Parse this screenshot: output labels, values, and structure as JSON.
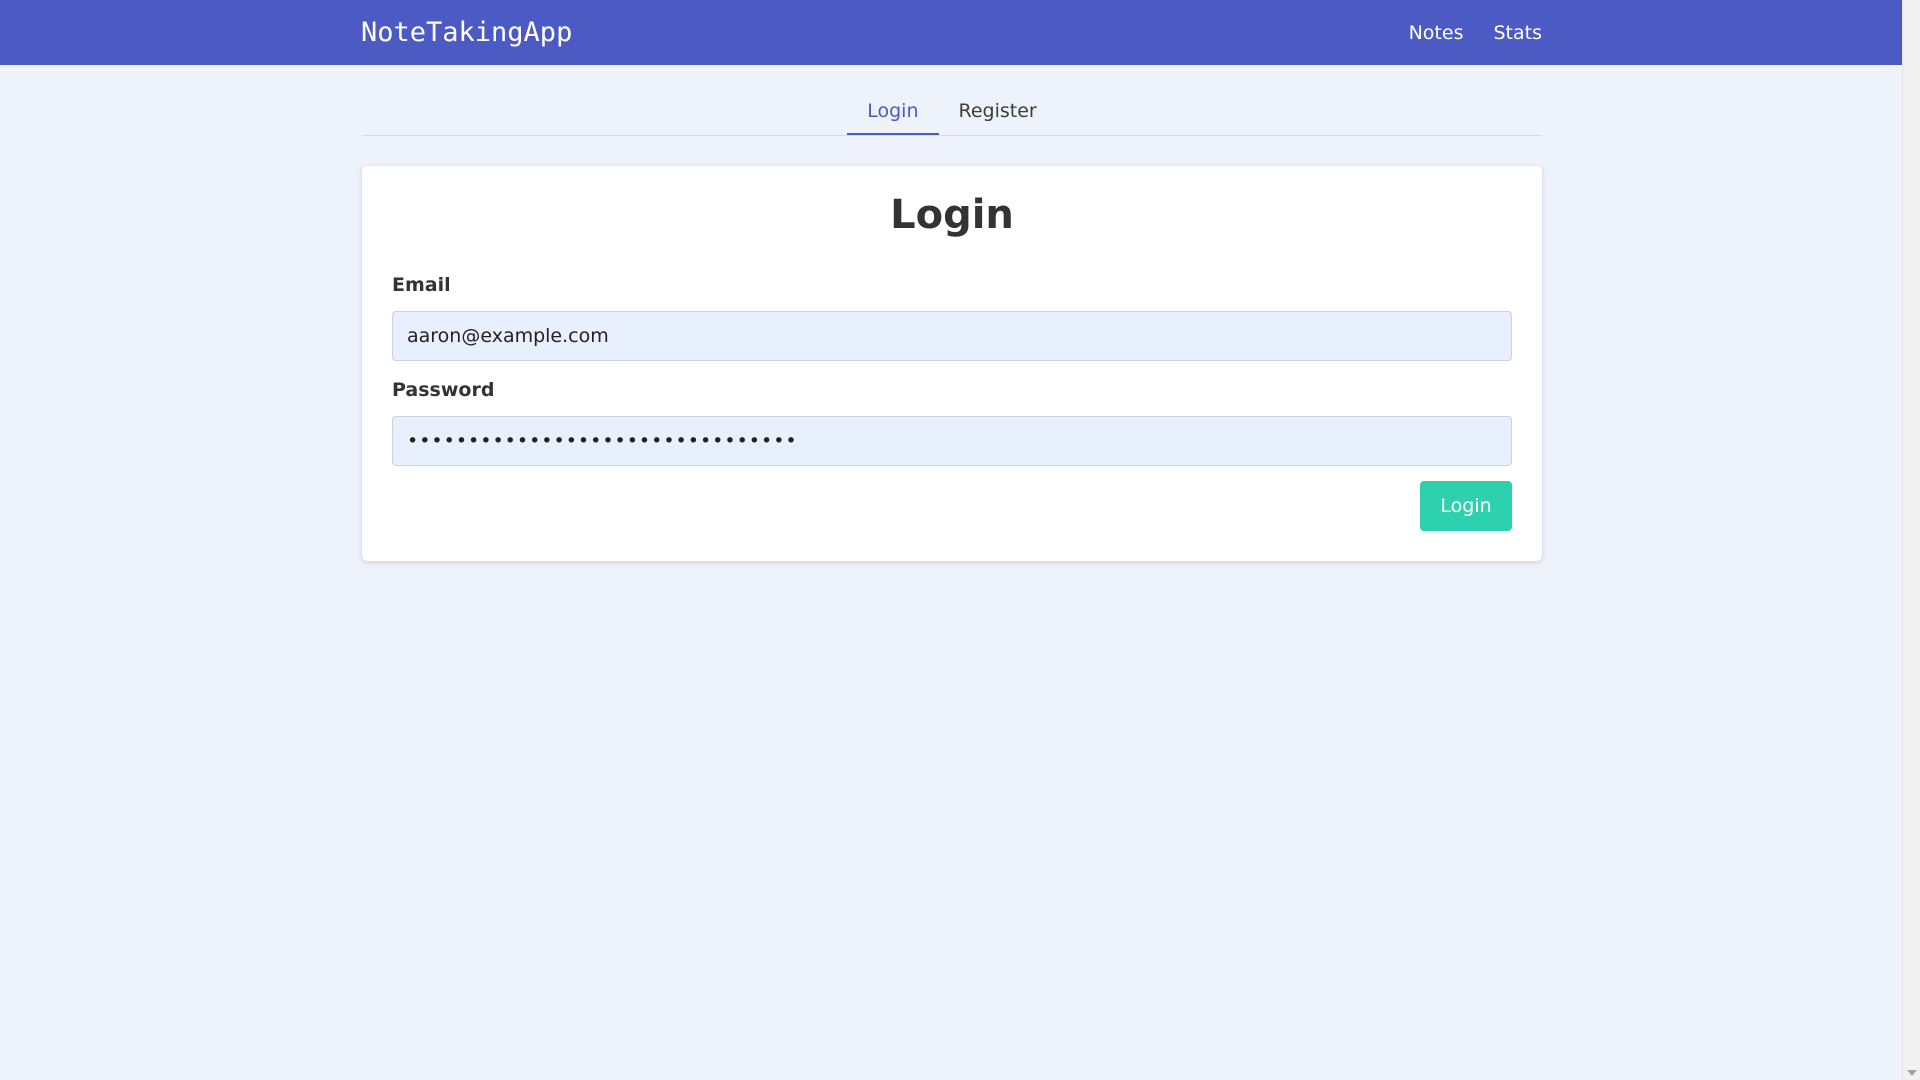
{
  "navbar": {
    "brand": "NoteTakingApp",
    "links": [
      "Notes",
      "Stats"
    ],
    "background": "#4c5ac4"
  },
  "tabs": [
    {
      "label": "Login",
      "active": true
    },
    {
      "label": "Register",
      "active": false
    }
  ],
  "form": {
    "title": "Login",
    "email_label": "Email",
    "email_value": "aaron@example.com",
    "password_label": "Password",
    "password_value": "••••••••••••••••••••••••••••••••",
    "submit_label": "Login",
    "submit_color": "#2ed1ad"
  },
  "colors": {
    "page_background": "#eef3fb",
    "accent": "#4c5ac4",
    "input_background": "#e8f0fe"
  }
}
